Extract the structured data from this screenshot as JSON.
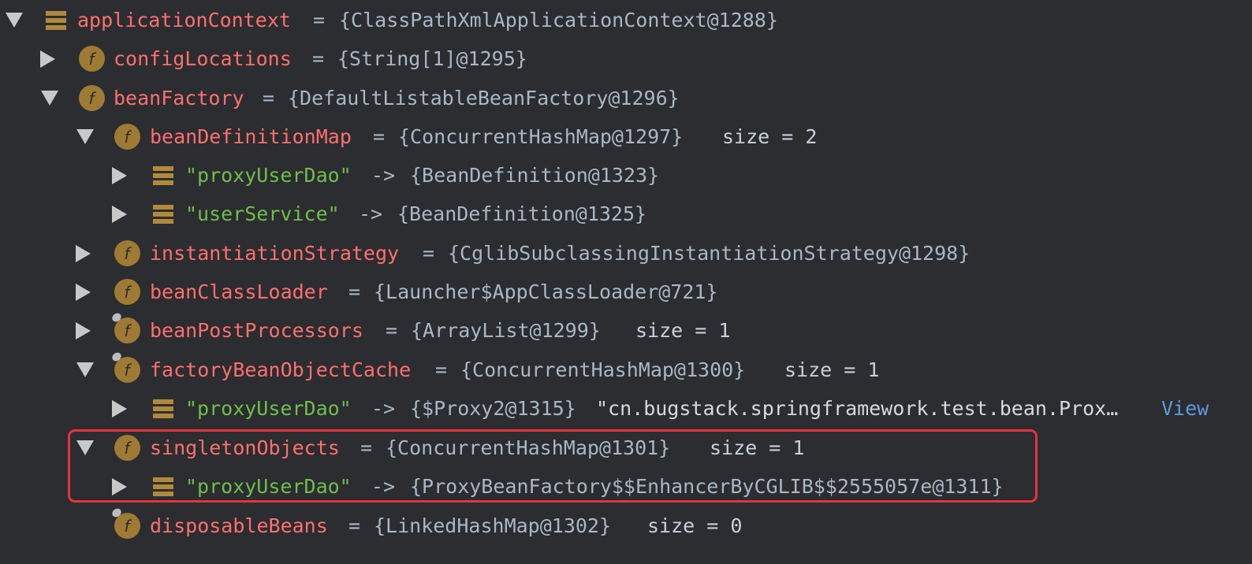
{
  "rows": [
    {
      "name": "applicationContext",
      "eq": "=",
      "value": "{ClassPathXmlApplicationContext@1288}"
    },
    {
      "name": "configLocations",
      "eq": "=",
      "value": "{String[1]@1295}"
    },
    {
      "name": "beanFactory",
      "eq": "=",
      "value": "{DefaultListableBeanFactory@1296}"
    },
    {
      "name": "beanDefinitionMap",
      "eq": "=",
      "value": "{ConcurrentHashMap@1297}",
      "size": "size = 2"
    },
    {
      "key": "\"proxyUserDao\"",
      "arrow": "->",
      "value": "{BeanDefinition@1323}"
    },
    {
      "key": "\"userService\"",
      "arrow": "->",
      "value": "{BeanDefinition@1325}"
    },
    {
      "name": "instantiationStrategy",
      "eq": "=",
      "value": "{CglibSubclassingInstantiationStrategy@1298}"
    },
    {
      "name": "beanClassLoader",
      "eq": "=",
      "value": "{Launcher$AppClassLoader@721}"
    },
    {
      "name": "beanPostProcessors",
      "eq": "=",
      "value": "{ArrayList@1299}",
      "size": "size = 1"
    },
    {
      "name": "factoryBeanObjectCache",
      "eq": "=",
      "value": "{ConcurrentHashMap@1300}",
      "size": "size = 1"
    },
    {
      "key": "\"proxyUserDao\"",
      "arrow": "->",
      "value": "{$Proxy2@1315}",
      "extra": "\"cn.bugstack.springframework.test.bean.Prox…",
      "link": "View"
    },
    {
      "name": "singletonObjects",
      "eq": "=",
      "value": "{ConcurrentHashMap@1301}",
      "size": "size = 1"
    },
    {
      "key": "\"proxyUserDao\"",
      "arrow": "->",
      "value": "{ProxyBeanFactory$$EnhancerByCGLIB$$2555057e@1311}"
    },
    {
      "name": "disposableBeans",
      "eq": "=",
      "value": "{LinkedHashMap@1302}",
      "size": "size = 0"
    }
  ],
  "icons": {
    "field_letter": "f"
  },
  "colors": {
    "background": "#2b2d30",
    "field_name": "#ff6f6f",
    "string_key": "#6fbf4a",
    "highlight_box": "#e8333f",
    "link": "#5d9bdc"
  }
}
